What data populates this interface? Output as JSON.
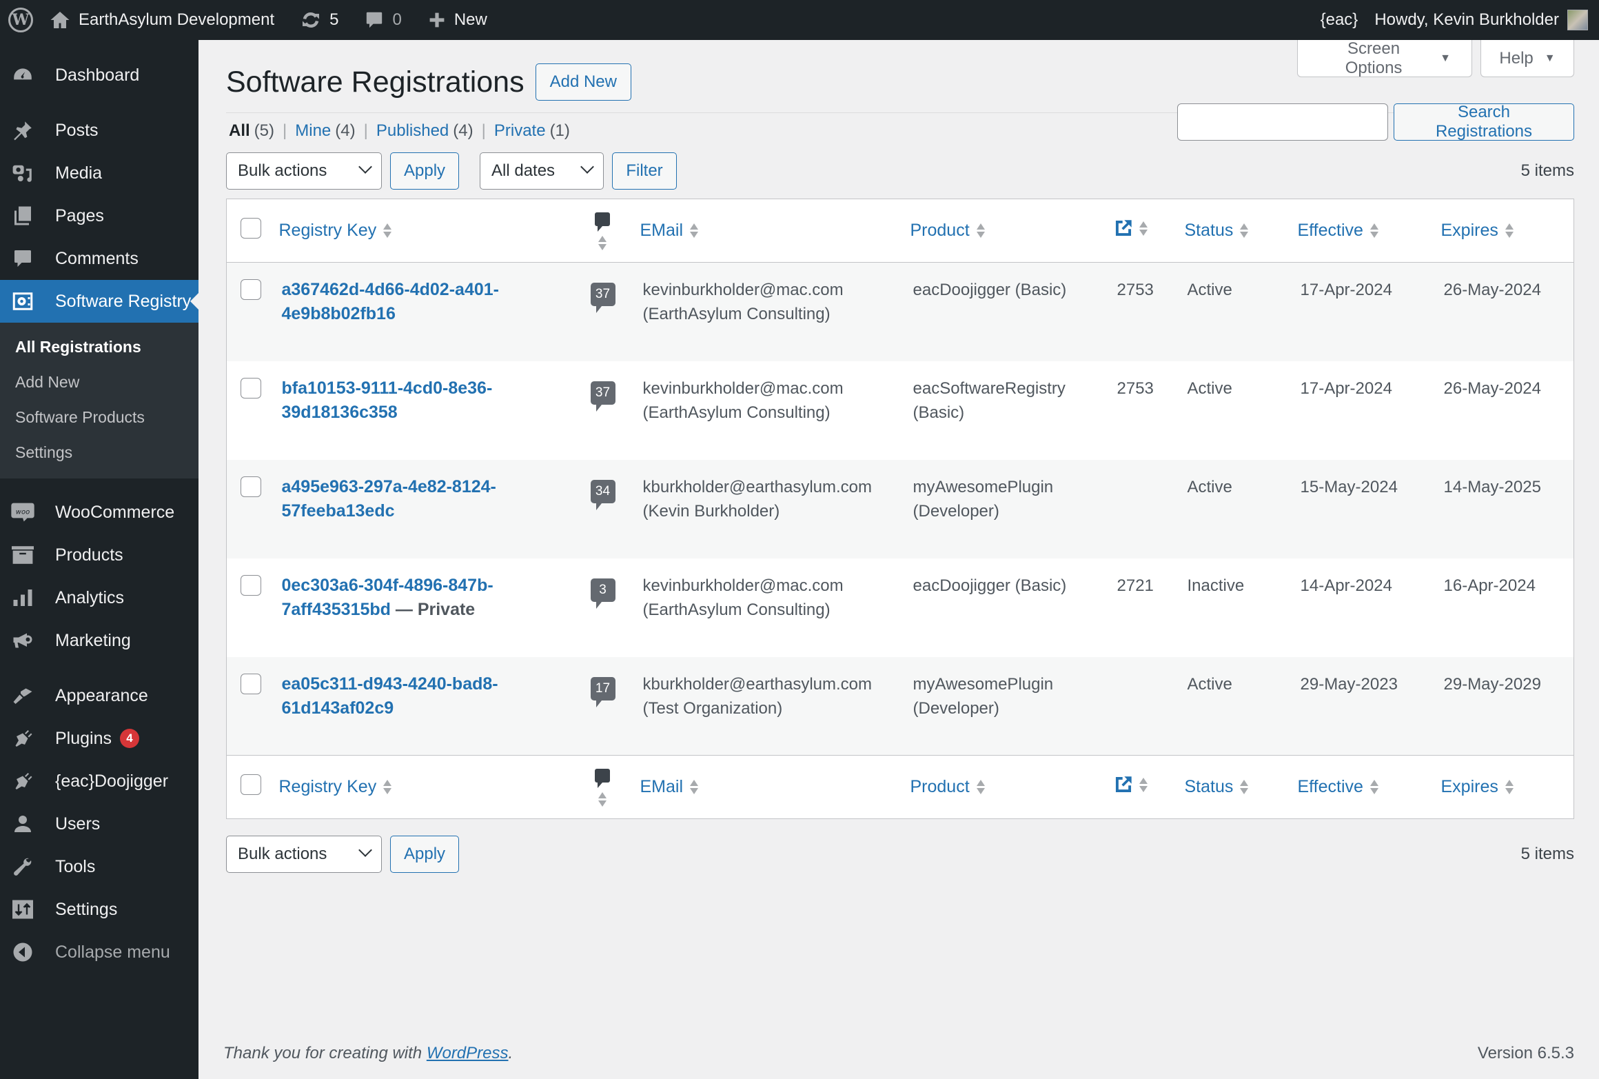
{
  "admin_bar": {
    "site_name": "EarthAsylum Development",
    "updates_count": "5",
    "comments_count": "0",
    "new_label": "New",
    "eac_label": "{eac}",
    "howdy": "Howdy, Kevin Burkholder"
  },
  "sidebar": {
    "items": [
      {
        "label": "Dashboard",
        "icon": "dashboard-icon"
      },
      {
        "label": "Posts",
        "icon": "pin-icon"
      },
      {
        "label": "Media",
        "icon": "media-icon"
      },
      {
        "label": "Pages",
        "icon": "pages-icon"
      },
      {
        "label": "Comments",
        "icon": "comment-icon"
      },
      {
        "label": "Software Registry",
        "icon": "registry-icon",
        "current": true
      },
      {
        "label": "WooCommerce",
        "icon": "woo-icon"
      },
      {
        "label": "Products",
        "icon": "archive-icon"
      },
      {
        "label": "Analytics",
        "icon": "bar-chart-icon"
      },
      {
        "label": "Marketing",
        "icon": "megaphone-icon"
      },
      {
        "label": "Appearance",
        "icon": "paintbrush-icon"
      },
      {
        "label": "Plugins",
        "icon": "plugin-icon",
        "badge": "4"
      },
      {
        "label": "{eac}Doojigger",
        "icon": "plugin-icon"
      },
      {
        "label": "Users",
        "icon": "user-icon"
      },
      {
        "label": "Tools",
        "icon": "wrench-icon"
      },
      {
        "label": "Settings",
        "icon": "settings-icon"
      }
    ],
    "submenu": [
      "All Registrations",
      "Add New",
      "Software Products",
      "Settings"
    ],
    "collapse_label": "Collapse menu"
  },
  "screen_meta": {
    "screen_options": "Screen Options",
    "help": "Help"
  },
  "page": {
    "title": "Software Registrations",
    "add_new": "Add New",
    "views": [
      {
        "label": "All",
        "count": "(5)",
        "current": true
      },
      {
        "label": "Mine",
        "count": "(4)"
      },
      {
        "label": "Published",
        "count": "(4)"
      },
      {
        "label": "Private",
        "count": "(1)"
      }
    ],
    "search": {
      "value": "",
      "placeholder": "",
      "button": "Search Registrations"
    },
    "bulk_actions": "Bulk actions",
    "apply": "Apply",
    "dates": "All dates",
    "filter": "Filter",
    "items_count": "5 items"
  },
  "table": {
    "columns": {
      "registry_key": "Registry Key",
      "email": "EMail",
      "product": "Product",
      "status": "Status",
      "effective": "Effective",
      "expires": "Expires"
    },
    "rows": [
      {
        "key_line1": "a367462d-4d66-4d02-a401-",
        "key_line2": "4e9b8b02fb16",
        "state": "",
        "comments": "37",
        "email": "kevinburkholder@mac.com",
        "org": "(EarthAsylum Consulting)",
        "product": "eacDoojigger (Basic)",
        "link_id": "2753",
        "status": "Active",
        "effective": "17-Apr-2024",
        "expires": "26-May-2024"
      },
      {
        "key_line1": "bfa10153-9111-4cd0-8e36-",
        "key_line2": "39d18136c358",
        "state": "",
        "comments": "37",
        "email": "kevinburkholder@mac.com",
        "org": "(EarthAsylum Consulting)",
        "product": "eacSoftwareRegistry (Basic)",
        "link_id": "2753",
        "status": "Active",
        "effective": "17-Apr-2024",
        "expires": "26-May-2024"
      },
      {
        "key_line1": "a495e963-297a-4e82-8124-",
        "key_line2": "57feeba13edc",
        "state": "",
        "comments": "34",
        "email": "kburkholder@earthasylum.com",
        "org": "(Kevin Burkholder)",
        "product": "myAwesomePlugin (Developer)",
        "link_id": "",
        "status": "Active",
        "effective": "15-May-2024",
        "expires": "14-May-2025"
      },
      {
        "key_line1": "0ec303a6-304f-4896-847b-",
        "key_line2": "7aff435315bd",
        "state": " — Private",
        "comments": "3",
        "email": "kevinburkholder@mac.com",
        "org": "(EarthAsylum Consulting)",
        "product": "eacDoojigger (Basic)",
        "link_id": "2721",
        "status": "Inactive",
        "effective": "14-Apr-2024",
        "expires": "16-Apr-2024"
      },
      {
        "key_line1": "ea05c311-d943-4240-bad8-",
        "key_line2": "61d143af02c9",
        "state": "",
        "comments": "17",
        "email": "kburkholder@earthasylum.com",
        "org": "(Test Organization)",
        "product": "myAwesomePlugin (Developer)",
        "link_id": "",
        "status": "Active",
        "effective": "29-May-2023",
        "expires": "29-May-2029"
      }
    ]
  },
  "footer": {
    "thanks_prefix": "Thank you for creating with ",
    "thanks_link": "WordPress",
    "thanks_suffix": ".",
    "version": "Version 6.5.3"
  },
  "colors": {
    "accent": "#2271b1",
    "admin_bar_bg": "#1d2327",
    "badge": "#d63638"
  }
}
